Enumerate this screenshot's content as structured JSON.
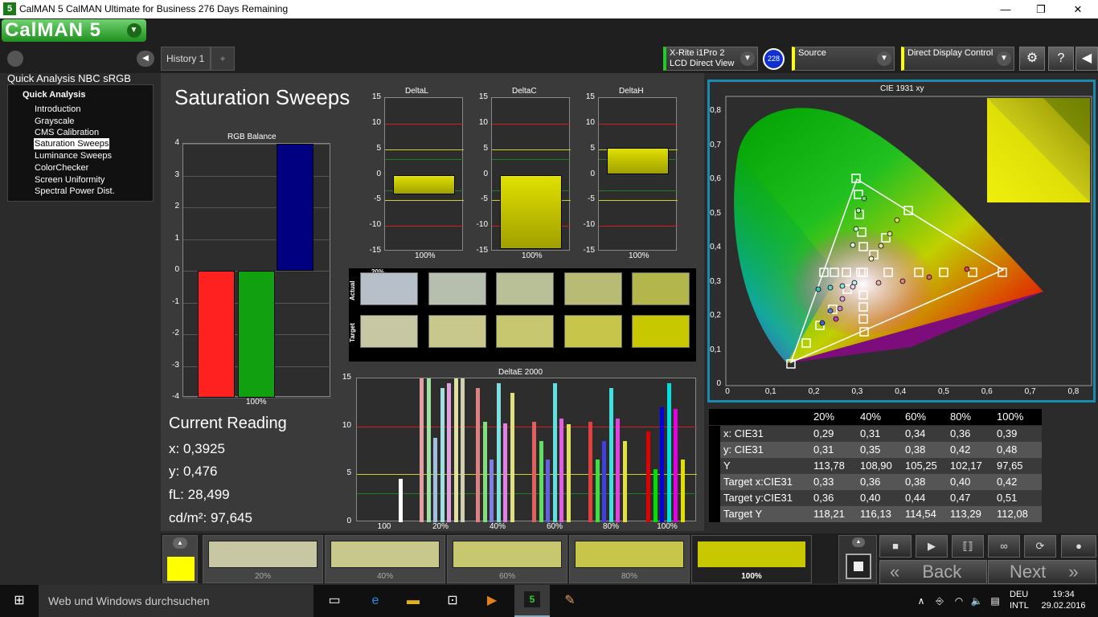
{
  "window": {
    "title": "CalMAN 5 CalMAN Ultimate for Business 276 Days Remaining",
    "icon_label": "5",
    "minimize": "—",
    "maximize": "❐",
    "close": "✕"
  },
  "app": {
    "logo": "CalMAN 5",
    "history_tab": "History 1",
    "add_tab": "+",
    "meter": {
      "line1": "X-Rite i1Pro 2",
      "line2": "LCD Direct View",
      "badge": "228"
    },
    "source": {
      "label": "Source"
    },
    "display": {
      "label": "Direct Display Control"
    }
  },
  "sidebar": {
    "title": "Quick Analysis NBC sRGB",
    "group": "Quick Analysis",
    "items": [
      "Introduction",
      "Grayscale",
      "CMS Calibration",
      "Saturation Sweeps",
      "Luminance Sweeps",
      "ColorChecker",
      "Screen Uniformity",
      "Spectral Power Dist."
    ],
    "selected": "Saturation Sweeps"
  },
  "page": {
    "title": "Saturation Sweeps"
  },
  "rgb_balance": {
    "title": "RGB Balance",
    "y_ticks": [
      "4",
      "3",
      "2",
      "1",
      "0",
      "-1",
      "-2",
      "-3",
      "-4"
    ],
    "x_label": "100%",
    "values": {
      "red": -4.0,
      "green": -4.0,
      "blue": 4.0
    },
    "ylim": [
      -4,
      4
    ]
  },
  "delta_l": {
    "title": "DeltaL",
    "x_label": "100%",
    "value": -3.8
  },
  "delta_c": {
    "title": "DeltaC",
    "x_label": "100%",
    "value": -14.5
  },
  "delta_h": {
    "title": "DeltaH",
    "x_label": "100%",
    "value": 5.2
  },
  "delta_ticks": [
    "15",
    "10",
    "5",
    "0",
    "-5",
    "-10",
    "-15"
  ],
  "swatches": {
    "actual_label": "Actual",
    "target_label": "Target",
    "levels": [
      "20%",
      "40%",
      "60%",
      "80%",
      "100%"
    ],
    "actual": [
      "#b7c0c9",
      "#b6beae",
      "#b9c097",
      "#b7bb74",
      "#b3b64a"
    ],
    "target": [
      "#c7c7a4",
      "#c8c88c",
      "#c7c76f",
      "#c7c64b",
      "#c8c800"
    ]
  },
  "delta_e": {
    "title": "DeltaE 2000",
    "y_ticks": [
      "15",
      "10",
      "5",
      "0"
    ],
    "x_labels": [
      "100",
      "20%",
      "40%",
      "60%",
      "80%",
      "100%"
    ]
  },
  "current_reading": {
    "title": "Current Reading",
    "x": "x: 0,3925",
    "y": "y: 0,476",
    "fl": "fL: 28,499",
    "cdm2": "cd/m²: 97,645"
  },
  "cie": {
    "title": "CIE 1931 xy",
    "y_ticks": [
      "0,8",
      "0,7",
      "0,6",
      "0,5",
      "0,4",
      "0,3",
      "0,2",
      "0,1",
      "0"
    ],
    "x_ticks": [
      "0",
      "0,1",
      "0,2",
      "0,3",
      "0,4",
      "0,5",
      "0,6",
      "0,7",
      "0,8"
    ]
  },
  "table": {
    "headers": [
      "20%",
      "40%",
      "60%",
      "80%",
      "100%"
    ],
    "rows": [
      {
        "label": "x: CIE31",
        "values": [
          "0,29",
          "0,31",
          "0,34",
          "0,36",
          "0,39"
        ]
      },
      {
        "label": "y: CIE31",
        "values": [
          "0,31",
          "0,35",
          "0,38",
          "0,42",
          "0,48"
        ]
      },
      {
        "label": "Y",
        "values": [
          "113,78",
          "108,90",
          "105,25",
          "102,17",
          "97,65"
        ]
      },
      {
        "label": "Target x:CIE31",
        "values": [
          "0,33",
          "0,36",
          "0,38",
          "0,40",
          "0,42"
        ]
      },
      {
        "label": "Target y:CIE31",
        "values": [
          "0,36",
          "0,40",
          "0,44",
          "0,47",
          "0,51"
        ]
      },
      {
        "label": "Target Y",
        "values": [
          "118,21",
          "116,13",
          "114,54",
          "113,29",
          "112,08"
        ]
      }
    ]
  },
  "patches": {
    "labels": [
      "20%",
      "40%",
      "60%",
      "80%",
      "100%"
    ],
    "colors": [
      "#c7c7a4",
      "#c8c88c",
      "#c7c76f",
      "#c7c64b",
      "#c8c800"
    ],
    "current_color": "#ffff00"
  },
  "controls": {
    "back": "Back",
    "next": "Next"
  },
  "taskbar": {
    "search": "Web und Windows durchsuchen",
    "lang1": "DEU",
    "lang2": "INTL",
    "time": "19:34",
    "date": "29.02.2016"
  }
}
